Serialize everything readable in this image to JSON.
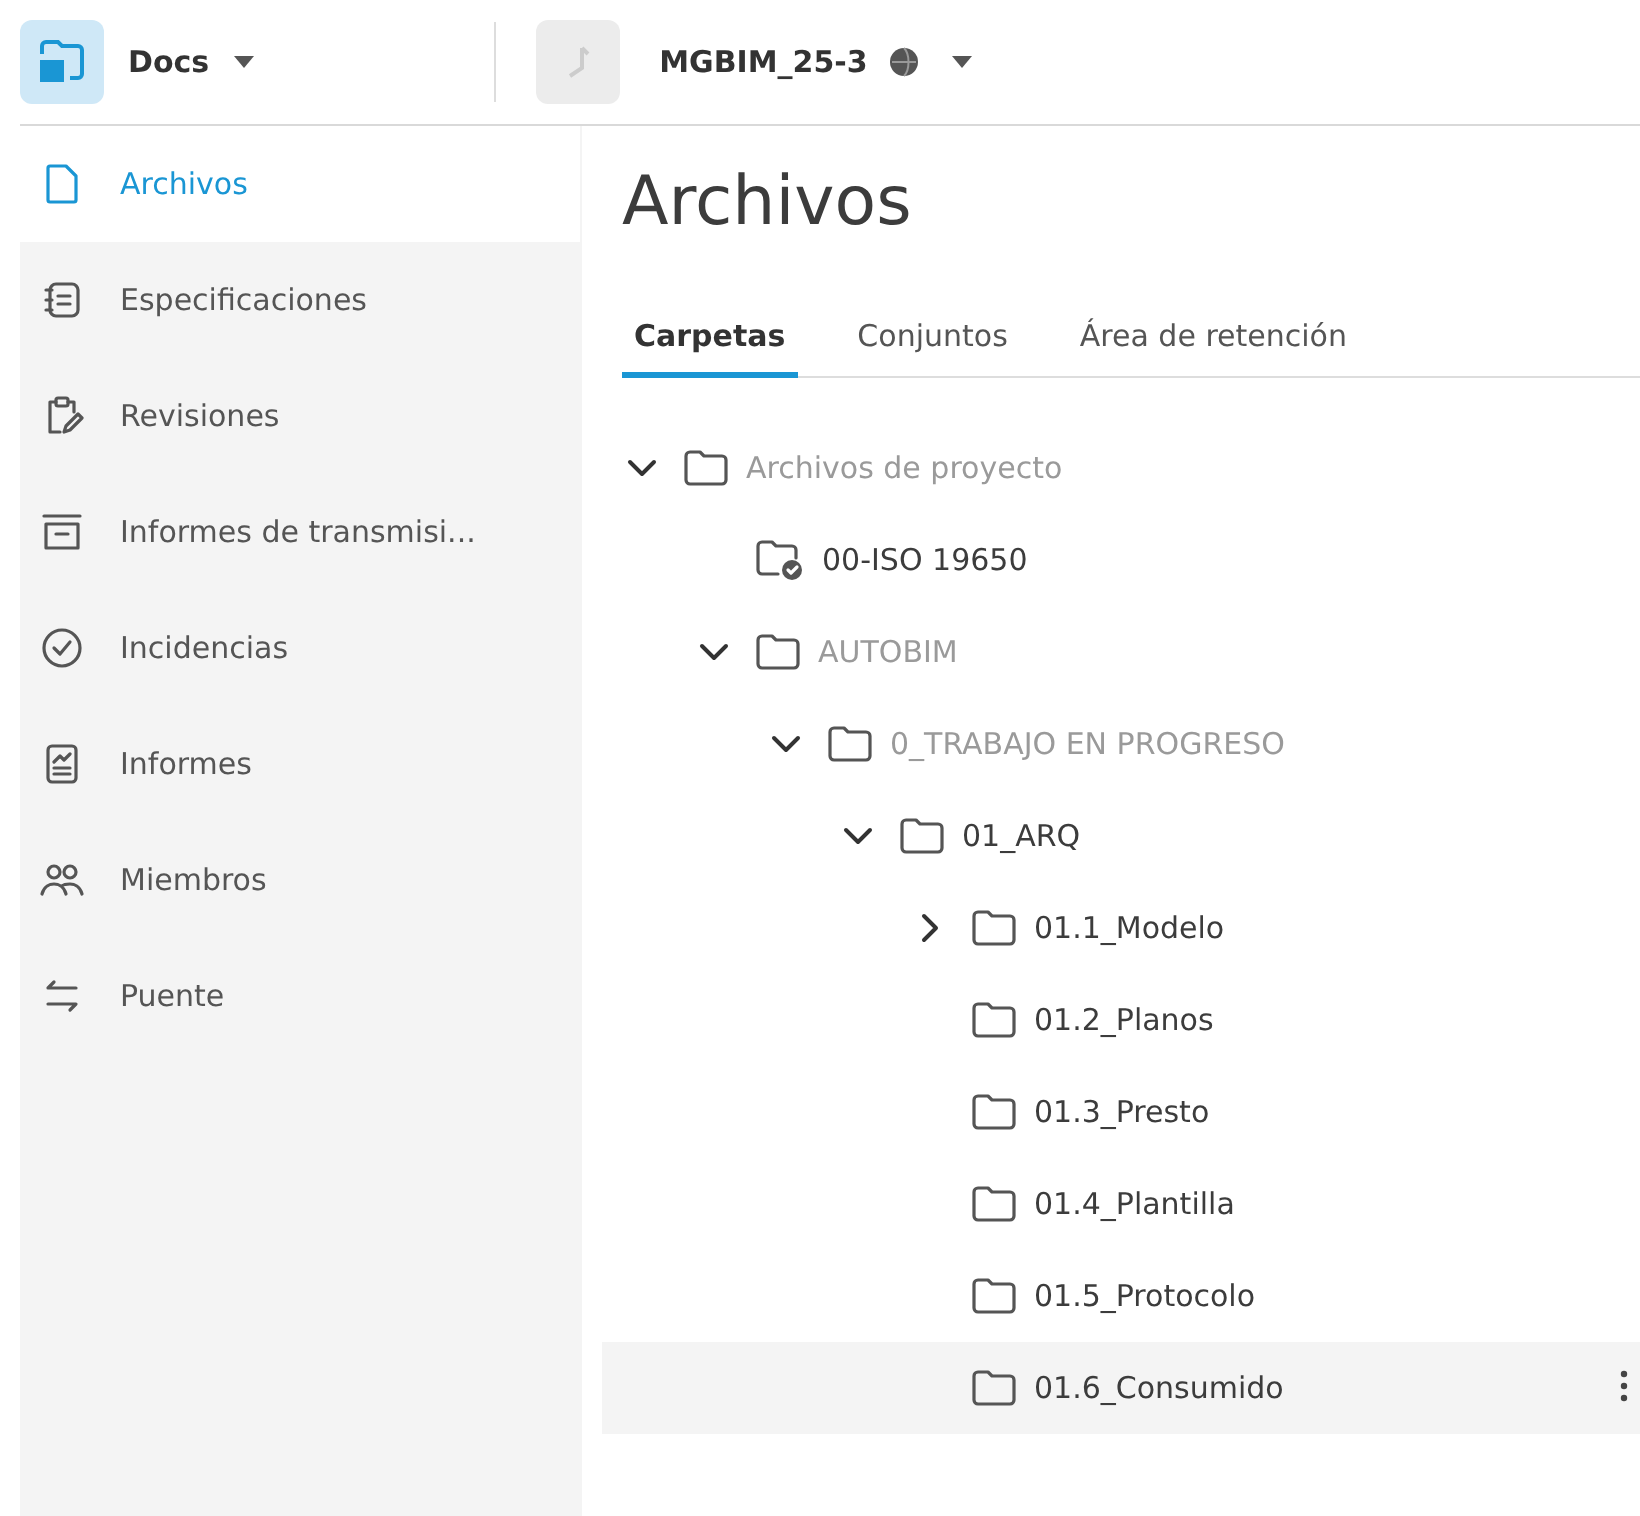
{
  "app_switcher": {
    "label": "Docs"
  },
  "project": {
    "name": "MGBIM_25-3"
  },
  "sidebar": {
    "items": [
      {
        "label": "Archivos",
        "kind": "file",
        "selected": true
      },
      {
        "label": "Especificaciones",
        "kind": "specs",
        "selected": false
      },
      {
        "label": "Revisiones",
        "kind": "review",
        "selected": false
      },
      {
        "label": "Informes de transmisi...",
        "kind": "archive",
        "selected": false
      },
      {
        "label": "Incidencias",
        "kind": "check",
        "selected": false
      },
      {
        "label": "Informes",
        "kind": "report",
        "selected": false
      },
      {
        "label": "Miembros",
        "kind": "members",
        "selected": false
      },
      {
        "label": "Puente",
        "kind": "bridge",
        "selected": false
      }
    ]
  },
  "page_title": "Archivos",
  "tabs": [
    {
      "label": "Carpetas",
      "selected": true
    },
    {
      "label": "Conjuntos",
      "selected": false
    },
    {
      "label": "Área de retención",
      "selected": false
    }
  ],
  "tree": [
    {
      "label": "Archivos de proyecto",
      "kind": "folder",
      "expanded": true,
      "dimmed": true,
      "highlighted": false,
      "children": [
        {
          "label": "00-ISO 19650",
          "kind": "checked-folder",
          "dimmed": false,
          "highlighted": false
        },
        {
          "label": "AUTOBIM",
          "kind": "folder",
          "expanded": true,
          "dimmed": true,
          "highlighted": false,
          "children": [
            {
              "label": "0_TRABAJO EN PROGRESO",
              "kind": "folder",
              "expanded": true,
              "dimmed": true,
              "highlighted": false,
              "children": [
                {
                  "label": "01_ARQ",
                  "kind": "folder",
                  "expanded": true,
                  "dimmed": false,
                  "highlighted": false,
                  "children": [
                    {
                      "label": "01.1_Modelo",
                      "kind": "folder",
                      "expanded": false,
                      "dimmed": false,
                      "highlighted": false
                    },
                    {
                      "label": "01.2_Planos",
                      "kind": "folder",
                      "dimmed": false,
                      "highlighted": false
                    },
                    {
                      "label": "01.3_Presto",
                      "kind": "folder",
                      "dimmed": false,
                      "highlighted": false
                    },
                    {
                      "label": "01.4_Plantilla",
                      "kind": "folder",
                      "dimmed": false,
                      "highlighted": false
                    },
                    {
                      "label": "01.5_Protocolo",
                      "kind": "folder",
                      "dimmed": false,
                      "highlighted": false
                    },
                    {
                      "label": "01.6_Consumido",
                      "kind": "folder",
                      "dimmed": false,
                      "highlighted": true
                    }
                  ]
                }
              ]
            }
          ]
        }
      ]
    }
  ]
}
